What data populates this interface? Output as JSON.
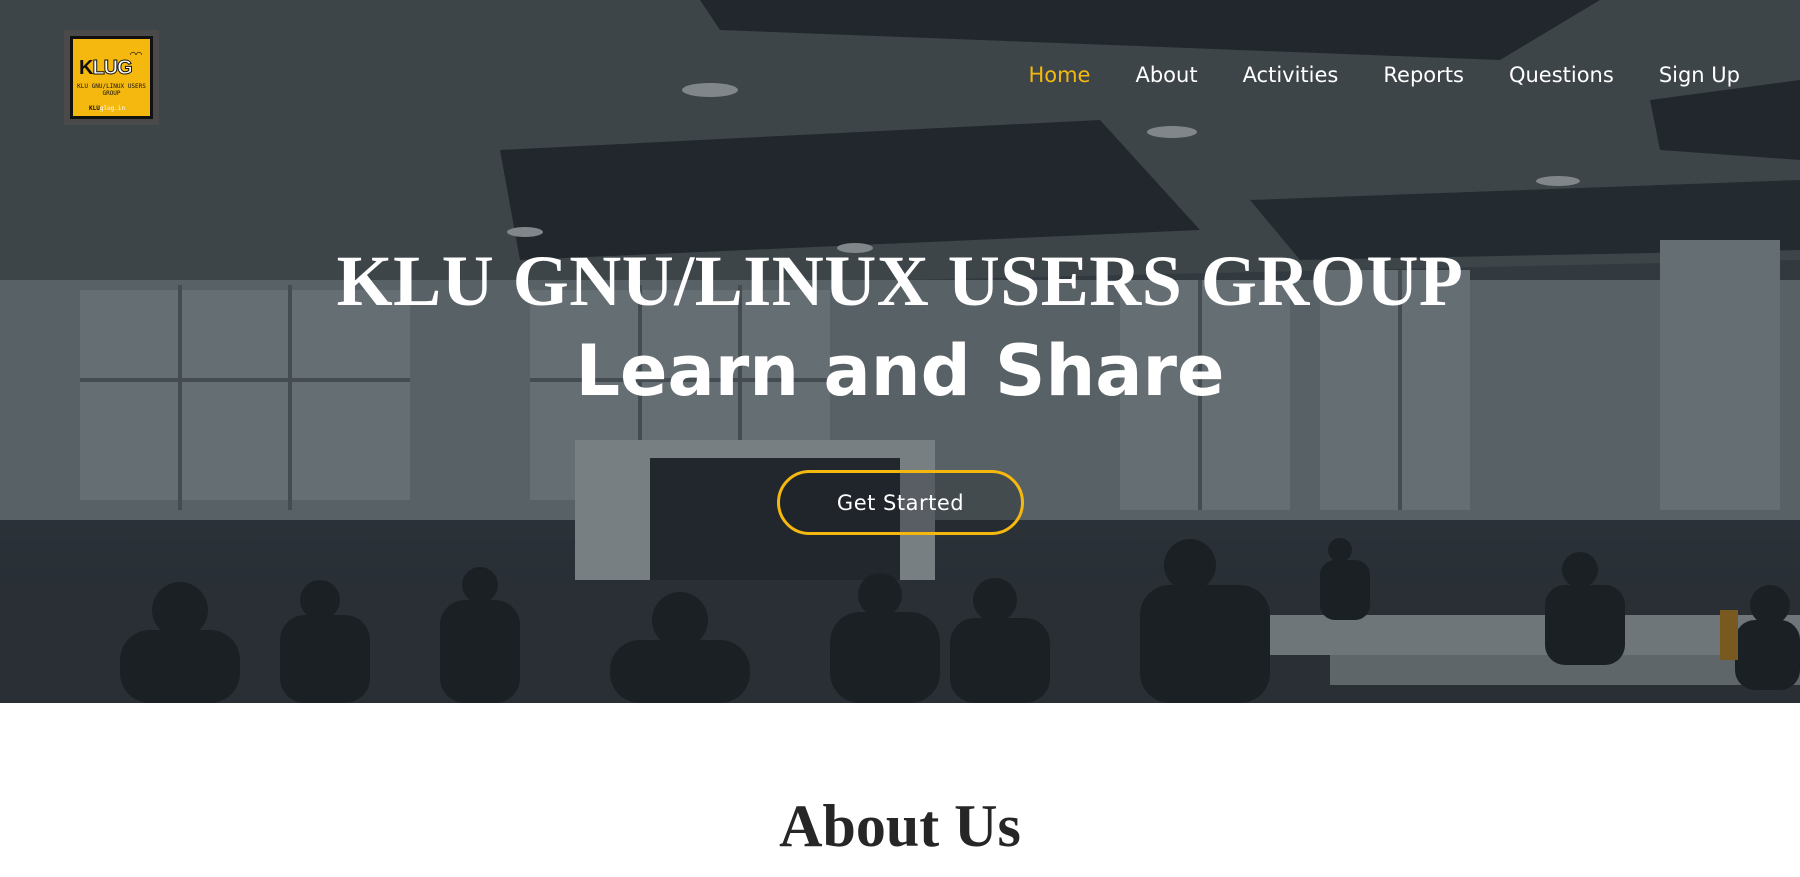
{
  "logo": {
    "mark_prefix": "K",
    "mark_text": "LUG",
    "birds": "⌒⌒",
    "subtitle": "KLU GNU/LINUX USERS GROUP",
    "url_prefix": "KLU",
    "url_suffix": "glug.in"
  },
  "nav": {
    "items": [
      {
        "label": "Home",
        "active": true
      },
      {
        "label": "About",
        "active": false
      },
      {
        "label": "Activities",
        "active": false
      },
      {
        "label": "Reports",
        "active": false
      },
      {
        "label": "Questions",
        "active": false
      },
      {
        "label": "Sign Up",
        "active": false
      }
    ]
  },
  "hero": {
    "title": "KLU GNU/LINUX USERS GROUP",
    "subtitle": "Learn and Share",
    "cta_label": "Get Started"
  },
  "about": {
    "title": "About Us"
  },
  "colors": {
    "accent": "#f5b80f",
    "text_light": "#ffffff",
    "text_dark": "#262626"
  }
}
